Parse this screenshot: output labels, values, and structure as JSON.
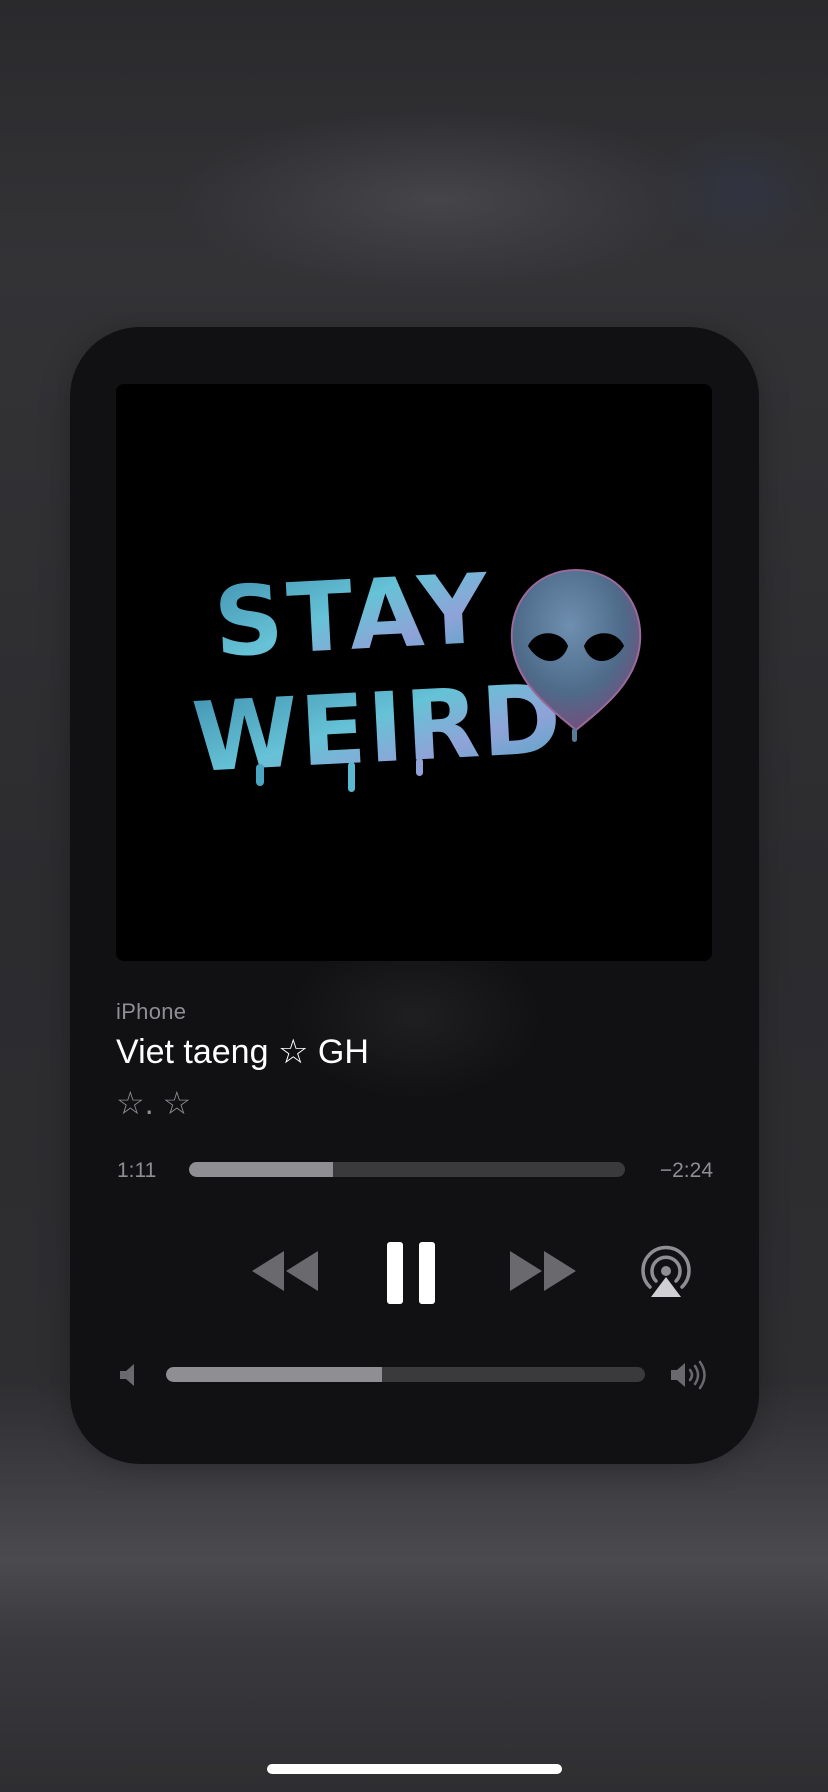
{
  "player": {
    "source_label": "iPhone",
    "track_title": "Viet taeng ☆ GH",
    "artist": "☆. ☆",
    "artwork": {
      "text_line1": "STAY",
      "text_line2": "WEIRD",
      "icon": "alien-head-icon"
    },
    "progress": {
      "elapsed": "1:11",
      "remaining": "−2:24",
      "fraction": 0.33
    },
    "controls": {
      "rewind_icon": "rewind-icon",
      "pause_icon": "pause-icon",
      "forward_icon": "fast-forward-icon",
      "airplay_icon": "airplay-audio-icon"
    },
    "volume": {
      "level": 0.45,
      "low_icon": "speaker-low-icon",
      "high_icon": "speaker-high-icon"
    }
  },
  "colors": {
    "background": "#2c2c2f",
    "card": "#111113",
    "primary_text": "#ffffff",
    "secondary_text": "#8e8e93",
    "track": "#3a3a3d",
    "fill": "#8e8e93",
    "artwork_accent": "#5ab8d0"
  }
}
